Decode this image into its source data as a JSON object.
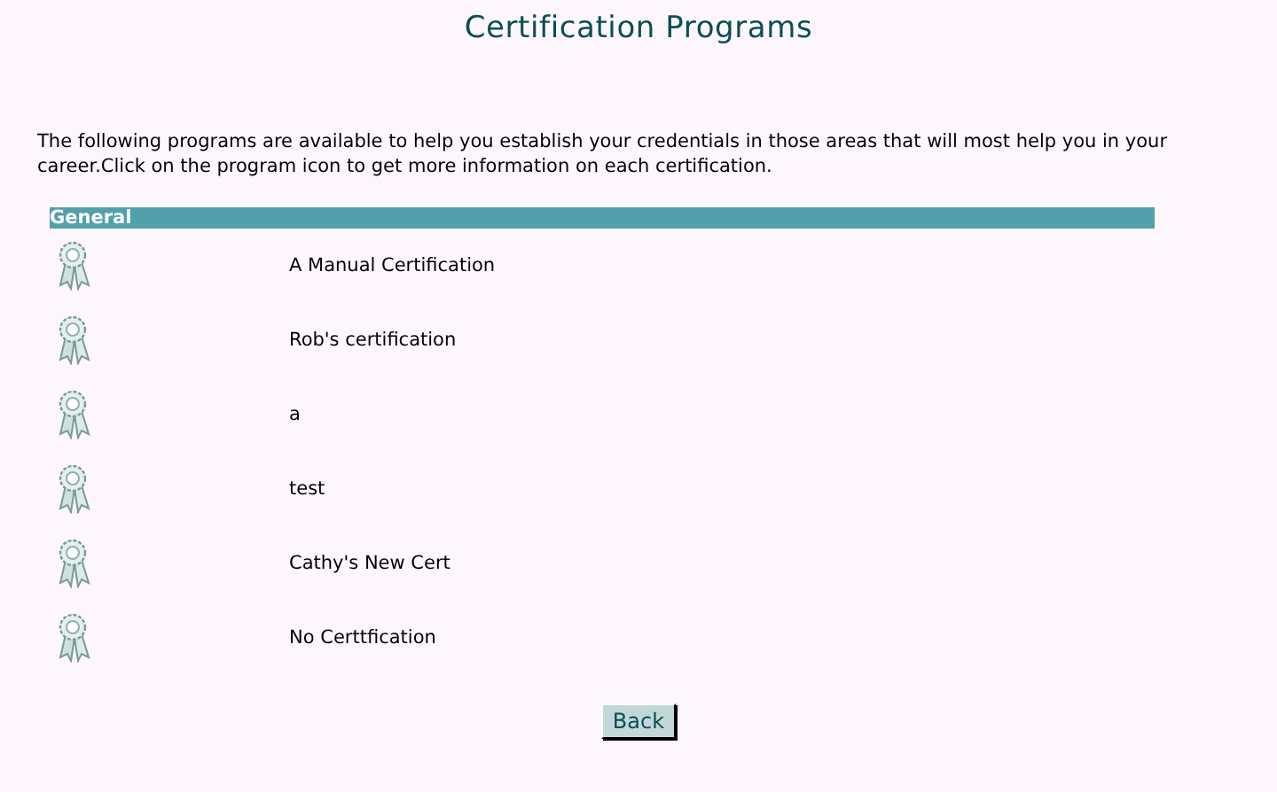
{
  "title": "Certification Programs",
  "intro": "The following programs are available to help you establish your credentials in those areas that will most help you in your career.Click on the program icon to get more information on each certification.",
  "section": {
    "heading": "General",
    "programs": [
      {
        "name": "A Manual Certification"
      },
      {
        "name": "Rob's certification"
      },
      {
        "name": "a"
      },
      {
        "name": "test"
      },
      {
        "name": "Cathy's New Cert"
      },
      {
        "name": "No Certtfication"
      }
    ]
  },
  "buttons": [
    "Back"
  ]
}
